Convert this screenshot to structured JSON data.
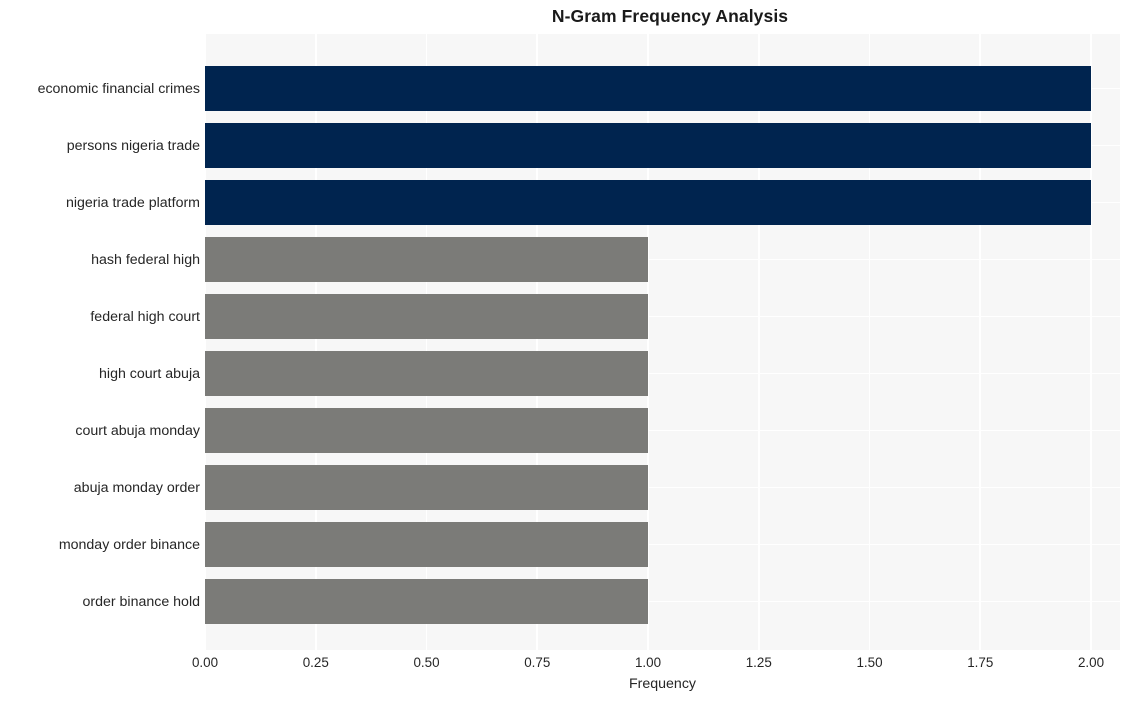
{
  "chart_data": {
    "type": "bar",
    "orientation": "horizontal",
    "title": "N-Gram Frequency Analysis",
    "xlabel": "Frequency",
    "ylabel": "",
    "xlim": [
      0,
      2.0
    ],
    "xticks": [
      "0.00",
      "0.25",
      "0.50",
      "0.75",
      "1.00",
      "1.25",
      "1.50",
      "1.75",
      "2.00"
    ],
    "xtick_values": [
      0,
      0.25,
      0.5,
      0.75,
      1.0,
      1.25,
      1.5,
      1.75,
      2.0
    ],
    "grid": true,
    "legend": "none",
    "categories": [
      "economic financial crimes",
      "persons nigeria trade",
      "nigeria trade platform",
      "hash federal high",
      "federal high court",
      "high court abuja",
      "court abuja monday",
      "abuja monday order",
      "monday order binance",
      "order binance hold"
    ],
    "values": [
      2,
      2,
      2,
      1,
      1,
      1,
      1,
      1,
      1,
      1
    ],
    "bar_colors": [
      "#00244f",
      "#00244f",
      "#00244f",
      "#7b7b78",
      "#7b7b78",
      "#7b7b78",
      "#7b7b78",
      "#7b7b78",
      "#7b7b78",
      "#7b7b78"
    ]
  },
  "style": {
    "figure_background": "#ffffff",
    "axes_background": "#f7f7f7",
    "gridline_color": "#ffffff",
    "text_color": "#262626",
    "title_color": "#1a1a1a"
  }
}
